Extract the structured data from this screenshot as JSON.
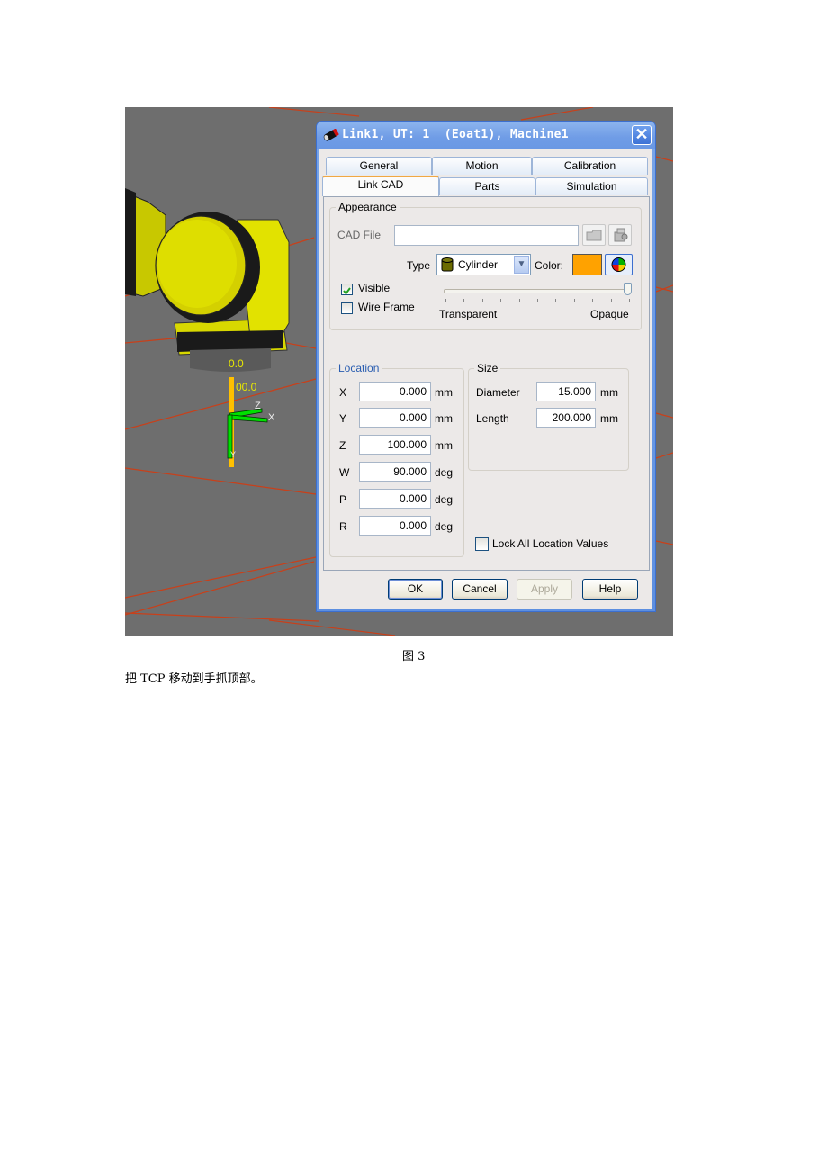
{
  "dialog": {
    "title": "Link1, UT: 1  (Eoat1), Machine1",
    "close_label": "✕",
    "tabs_row1": [
      {
        "label": "General"
      },
      {
        "label": "Motion"
      },
      {
        "label": "Calibration"
      }
    ],
    "tabs_row2": [
      {
        "label": "Link CAD",
        "active": true
      },
      {
        "label": "Parts"
      },
      {
        "label": "Simulation"
      }
    ],
    "appearance": {
      "group_label": "Appearance",
      "cad_file_label": "CAD File",
      "cad_file_value": "",
      "type_label": "Type",
      "type_value": "Cylinder",
      "color_label": "Color:",
      "color_value": "#ffa200",
      "visible_label": "Visible",
      "visible_checked": true,
      "wireframe_label": "Wire Frame",
      "wireframe_checked": false,
      "opacity_min_label": "Transparent",
      "opacity_max_label": "Opaque",
      "opacity_value": 1.0
    },
    "location": {
      "group_label": "Location",
      "rows": [
        {
          "axis": "X",
          "value": "0.000",
          "unit": "mm"
        },
        {
          "axis": "Y",
          "value": "0.000",
          "unit": "mm"
        },
        {
          "axis": "Z",
          "value": "100.000",
          "unit": "mm"
        },
        {
          "axis": "W",
          "value": "90.000",
          "unit": "deg"
        },
        {
          "axis": "P",
          "value": "0.000",
          "unit": "deg"
        },
        {
          "axis": "R",
          "value": "0.000",
          "unit": "deg"
        }
      ]
    },
    "size": {
      "group_label": "Size",
      "diameter_label": "Diameter",
      "diameter_value": "15.000",
      "diameter_unit": "mm",
      "length_label": "Length",
      "length_value": "200.000",
      "length_unit": "mm"
    },
    "lock_label": "Lock All Location Values",
    "lock_checked": false,
    "buttons": {
      "ok": "OK",
      "cancel": "Cancel",
      "apply": "Apply",
      "help": "Help"
    }
  },
  "viewport": {
    "labels": {
      "top_value": "0.0",
      "mid_value": "00.0",
      "axis_z": "Z",
      "axis_x": "X",
      "axis_y": "Y"
    },
    "colors": {
      "background": "#6e6e6e",
      "grid": "#c8401a",
      "robot": "#e6e600",
      "tool": "#ffc000",
      "frame": "#00e000"
    }
  },
  "document": {
    "caption": "图 3",
    "paragraph": "把 TCP 移动到手抓顶部。"
  }
}
